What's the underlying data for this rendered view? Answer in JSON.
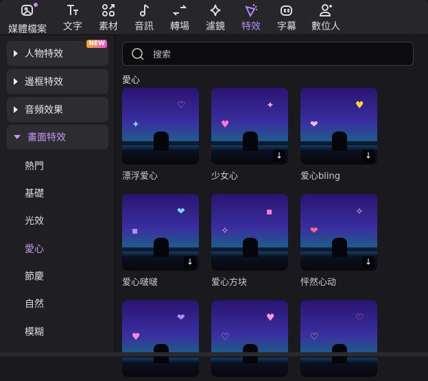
{
  "toolbar": {
    "items": [
      {
        "label": "媒體檔案",
        "icon": "media-icon"
      },
      {
        "label": "文字",
        "icon": "text-icon"
      },
      {
        "label": "素材",
        "icon": "elements-icon"
      },
      {
        "label": "音訊",
        "icon": "audio-icon"
      },
      {
        "label": "轉場",
        "icon": "transition-icon"
      },
      {
        "label": "濾鏡",
        "icon": "filter-icon"
      },
      {
        "label": "特效",
        "icon": "effects-icon"
      },
      {
        "label": "字幕",
        "icon": "captions-icon"
      },
      {
        "label": "數位人",
        "icon": "avatar-icon"
      }
    ],
    "active": "特效"
  },
  "sidebar": {
    "categories": [
      {
        "label": "人物特效",
        "badge": "NEW"
      },
      {
        "label": "邊框特效"
      },
      {
        "label": "音頻效果"
      },
      {
        "label": "畫面特效"
      }
    ],
    "subitems": [
      "熱門",
      "基礎",
      "光效",
      "愛心",
      "節慶",
      "自然",
      "模糊"
    ],
    "active_sub": "愛心"
  },
  "search": {
    "placeholder": "搜索"
  },
  "section_title": "愛心",
  "cards": [
    {
      "label": "漂浮爱心",
      "download": false
    },
    {
      "label": "少女心",
      "download": true
    },
    {
      "label": "爱心bling",
      "download": true
    },
    {
      "label": "爱心啵啵",
      "download": true
    },
    {
      "label": "爱心方块",
      "download": false
    },
    {
      "label": "怦然心动",
      "download": true
    },
    {
      "label": ""
    },
    {
      "label": ""
    },
    {
      "label": ""
    }
  ],
  "accent": "#b48cf5"
}
